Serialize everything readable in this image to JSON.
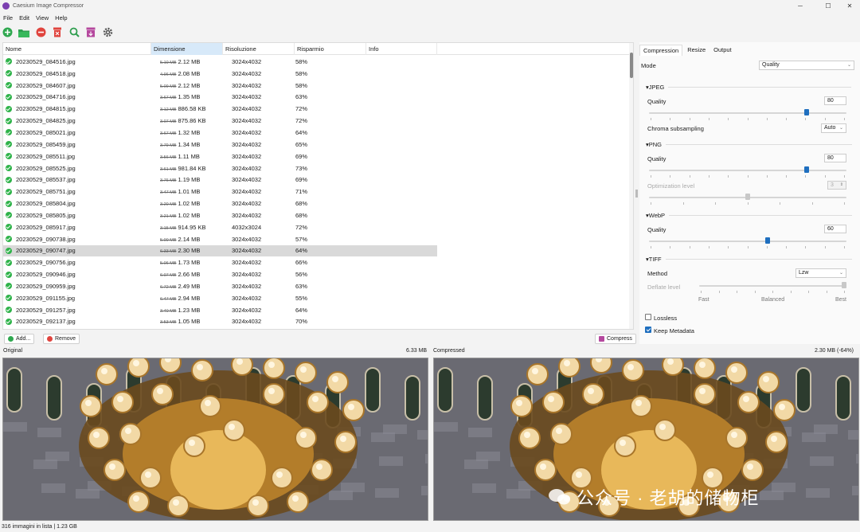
{
  "window": {
    "title": "Caesium Image Compressor",
    "minimize": "─",
    "maximize": "☐",
    "close": "✕"
  },
  "menu": [
    "File",
    "Edit",
    "View",
    "Help"
  ],
  "toolbar": {
    "icons": [
      "add-icon",
      "open-folder-icon",
      "remove-icon",
      "clear-icon",
      "search-icon",
      "export-icon",
      "settings-icon"
    ]
  },
  "table": {
    "columns": [
      "Nome",
      "Dimensione",
      "Risoluzione",
      "Risparmio",
      "Info"
    ],
    "sorted_column": "Dimensione",
    "rows": [
      {
        "name": "20230529_084516.jpg",
        "old": "5.10 MB",
        "new": "2.12 MB",
        "res": "3024x4032",
        "sav": "58%"
      },
      {
        "name": "20230529_084518.jpg",
        "old": "4.96 MB",
        "new": "2.08 MB",
        "res": "3024x4032",
        "sav": "58%"
      },
      {
        "name": "20230529_084607.jpg",
        "old": "5.09 MB",
        "new": "2.12 MB",
        "res": "3024x4032",
        "sav": "58%"
      },
      {
        "name": "20230529_084716.jpg",
        "old": "3.67 MB",
        "new": "1.35 MB",
        "res": "3024x4032",
        "sav": "63%"
      },
      {
        "name": "20230529_084815.jpg",
        "old": "3.12 MB",
        "new": "886.58 KB",
        "res": "3024x4032",
        "sav": "72%"
      },
      {
        "name": "20230529_084825.jpg",
        "old": "3.07 MB",
        "new": "875.86 KB",
        "res": "3024x4032",
        "sav": "72%"
      },
      {
        "name": "20230529_085021.jpg",
        "old": "3.67 MB",
        "new": "1.32 MB",
        "res": "3024x4032",
        "sav": "64%"
      },
      {
        "name": "20230529_085459.jpg",
        "old": "3.79 MB",
        "new": "1.34 MB",
        "res": "3024x4032",
        "sav": "65%"
      },
      {
        "name": "20230529_085511.jpg",
        "old": "3.56 MB",
        "new": "1.11 MB",
        "res": "3024x4032",
        "sav": "69%"
      },
      {
        "name": "20230529_085525.jpg",
        "old": "3.61 MB",
        "new": "981.84 KB",
        "res": "3024x4032",
        "sav": "73%"
      },
      {
        "name": "20230529_085537.jpg",
        "old": "3.76 MB",
        "new": "1.19 MB",
        "res": "3024x4032",
        "sav": "69%"
      },
      {
        "name": "20230529_085751.jpg",
        "old": "3.47 MB",
        "new": "1.01 MB",
        "res": "3024x4032",
        "sav": "71%"
      },
      {
        "name": "20230529_085804.jpg",
        "old": "3.20 MB",
        "new": "1.02 MB",
        "res": "3024x4032",
        "sav": "68%"
      },
      {
        "name": "20230529_085805.jpg",
        "old": "3.21 MB",
        "new": "1.02 MB",
        "res": "3024x4032",
        "sav": "68%"
      },
      {
        "name": "20230529_085917.jpg",
        "old": "3.15 MB",
        "new": "914.95 KB",
        "res": "4032x3024",
        "sav": "72%"
      },
      {
        "name": "20230529_090738.jpg",
        "old": "5.00 MB",
        "new": "2.14 MB",
        "res": "3024x4032",
        "sav": "57%"
      },
      {
        "name": "20230529_090747.jpg",
        "old": "6.33 MB",
        "new": "2.30 MB",
        "res": "3024x4032",
        "sav": "64%",
        "selected": true
      },
      {
        "name": "20230529_090756.jpg",
        "old": "5.06 MB",
        "new": "1.73 MB",
        "res": "3024x4032",
        "sav": "66%"
      },
      {
        "name": "20230529_090946.jpg",
        "old": "6.07 MB",
        "new": "2.66 MB",
        "res": "3024x4032",
        "sav": "56%"
      },
      {
        "name": "20230529_090959.jpg",
        "old": "6.72 MB",
        "new": "2.49 MB",
        "res": "3024x4032",
        "sav": "63%"
      },
      {
        "name": "20230529_091155.jpg",
        "old": "6.47 MB",
        "new": "2.94 MB",
        "res": "3024x4032",
        "sav": "55%"
      },
      {
        "name": "20230529_091257.jpg",
        "old": "3.40 MB",
        "new": "1.23 MB",
        "res": "3024x4032",
        "sav": "64%"
      },
      {
        "name": "20230529_092137.jpg",
        "old": "3.53 MB",
        "new": "1.05 MB",
        "res": "3024x4032",
        "sav": "70%"
      }
    ]
  },
  "actions": {
    "add": "Add...",
    "remove": "Remove",
    "compress": "Compress"
  },
  "settings": {
    "tabs": [
      "Compression",
      "Resize",
      "Output"
    ],
    "active_tab": "Compression",
    "mode_label": "Mode",
    "mode_value": "Quality",
    "jpeg": {
      "header": "JPEG",
      "quality_label": "Quality",
      "quality": "80",
      "quality_level": 0.8,
      "chroma_label": "Chroma subsampling",
      "chroma_value": "Auto"
    },
    "png": {
      "header": "PNG",
      "quality_label": "Quality",
      "quality": "80",
      "quality_level": 0.8,
      "opt_label": "Optimization level",
      "opt_value": "3",
      "opt_level": 0.5
    },
    "webp": {
      "header": "WebP",
      "quality_label": "Quality",
      "quality": "60",
      "quality_level": 0.6
    },
    "tiff": {
      "header": "TIFF",
      "method_label": "Method",
      "method_value": "Lzw",
      "deflate_label": "Deflate level",
      "deflate_fast": "Fast",
      "deflate_balanced": "Balanced",
      "deflate_best": "Best",
      "deflate_level": 1.0
    },
    "lossless_label": "Lossless",
    "lossless_checked": false,
    "metadata_label": "Keep Metadata",
    "metadata_checked": true
  },
  "preview": {
    "original_label": "Original",
    "original_size": "6.33 MB",
    "compressed_label": "Compressed",
    "compressed_size": "2.30 MB (-64%)"
  },
  "status": "316 immagini in lista | 1.23 GB",
  "watermark": "公众号 · 老胡的储物柜"
}
